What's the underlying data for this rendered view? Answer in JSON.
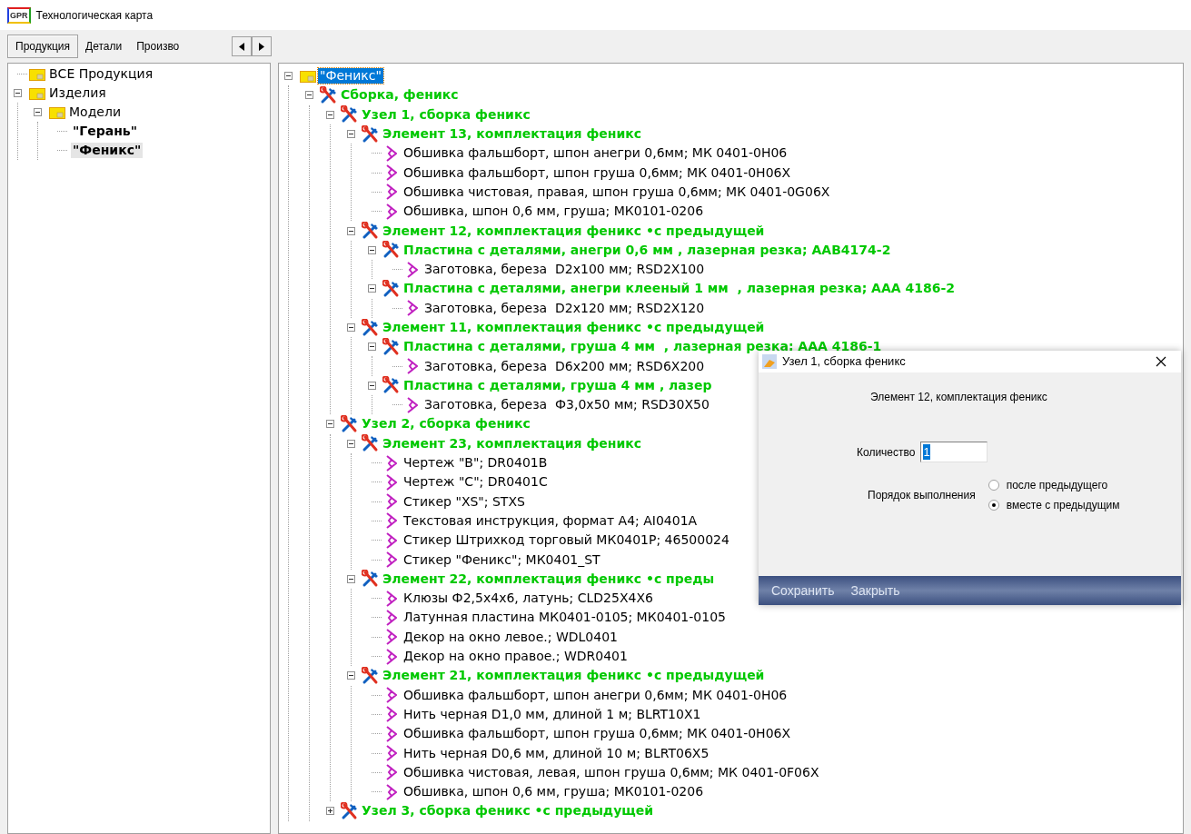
{
  "window": {
    "logo": "GPR",
    "title": "Технологическая карта"
  },
  "tabs": [
    {
      "label": "Продукция",
      "selected": true
    },
    {
      "label": "Детали",
      "selected": false
    },
    {
      "label": "Произво",
      "selected": false
    }
  ],
  "catalog": {
    "nodes": [
      {
        "label": "ВСЕ Продукция",
        "kind": "folder",
        "selected": false
      },
      {
        "label": "Изделия",
        "kind": "folder",
        "expanded": true,
        "selected": false,
        "children": [
          {
            "label": "Модели",
            "kind": "folder",
            "expanded": true,
            "selected": false,
            "children": [
              {
                "label": "\"Герань\"",
                "kind": "model",
                "selected": false
              },
              {
                "label": "\"Феникс\"",
                "kind": "model",
                "selected": true
              }
            ]
          }
        ]
      }
    ]
  },
  "tree": {
    "nodes": [
      {
        "label": "\"Феникс\"",
        "kind": "folder",
        "expanded": true,
        "selected": true,
        "children": [
          {
            "label": "Сборка, феникс",
            "kind": "assembly",
            "expanded": true,
            "selected": false,
            "children": [
              {
                "label": "Узел 1, сборка феникс",
                "kind": "assembly",
                "expanded": true,
                "selected": false,
                "children": [
                  {
                    "label": "Элемент 13, комплектация феникс",
                    "kind": "assembly",
                    "expanded": true,
                    "selected": false,
                    "children": [
                      {
                        "label": "Обшивка фальшборт, шпон анегри 0,6мм; МК 0401-0Н06",
                        "kind": "part",
                        "selected": false
                      },
                      {
                        "label": "Обшивка фальшборт, шпон груша 0,6мм; МК 0401-0Н06Х",
                        "kind": "part",
                        "selected": false
                      },
                      {
                        "label": "Обшивка чистовая, правая, шпон груша 0,6мм; МК 0401-0G06X",
                        "kind": "part",
                        "selected": false
                      },
                      {
                        "label": "Обшивка, шпон 0,6 мм, груша; МК0101-0206",
                        "kind": "part",
                        "selected": false
                      }
                    ]
                  },
                  {
                    "label": "Элемент 12, комплектация феникс •с предыдущей",
                    "kind": "assembly",
                    "expanded": true,
                    "selected": false,
                    "children": [
                      {
                        "label": "Пластина с деталями, анегри 0,6 мм , лазерная резка; ААВ4174-2",
                        "kind": "assembly",
                        "expanded": true,
                        "selected": false,
                        "children": [
                          {
                            "label": "Заготовка, береза  D2x100 мм; RSD2X100",
                            "kind": "part",
                            "selected": false
                          }
                        ]
                      },
                      {
                        "label": "Пластина с деталями, анегри клееный 1 мм  , лазерная резка; ААА 4186-2",
                        "kind": "assembly",
                        "expanded": true,
                        "selected": false,
                        "children": [
                          {
                            "label": "Заготовка, береза  D2x120 мм; RSD2X120",
                            "kind": "part",
                            "selected": false
                          }
                        ]
                      }
                    ]
                  },
                  {
                    "label": "Элемент 11, комплектация феникс •с предыдущей",
                    "kind": "assembly",
                    "expanded": true,
                    "selected": false,
                    "children": [
                      {
                        "label": "Пластина с деталями, груша 4 мм  , лазерная резка; ААА 4186-1",
                        "kind": "assembly",
                        "expanded": true,
                        "selected": false,
                        "children": [
                          {
                            "label": "Заготовка, береза  D6x200 мм; RSD6X200",
                            "kind": "part",
                            "selected": false
                          }
                        ]
                      },
                      {
                        "label": "Пластина с деталями, груша 4 мм , лазер",
                        "kind": "assembly",
                        "expanded": true,
                        "selected": false,
                        "children": [
                          {
                            "label": "Заготовка, береза  Ф3,0x50 мм; RSD30X50",
                            "kind": "part",
                            "selected": false
                          }
                        ]
                      }
                    ]
                  }
                ]
              },
              {
                "label": "Узел 2, сборка феникс",
                "kind": "assembly",
                "expanded": true,
                "selected": false,
                "children": [
                  {
                    "label": "Элемент 23, комплектация феникс",
                    "kind": "assembly",
                    "expanded": true,
                    "selected": false,
                    "children": [
                      {
                        "label": "Чертеж \"B\"; DR0401B",
                        "kind": "part",
                        "selected": false
                      },
                      {
                        "label": "Чертеж \"C\"; DR0401C",
                        "kind": "part",
                        "selected": false
                      },
                      {
                        "label": "Стикер \"XS\"; STXS",
                        "kind": "part",
                        "selected": false
                      },
                      {
                        "label": "Текстовая инструкция, формат А4; AI0401A",
                        "kind": "part",
                        "selected": false
                      },
                      {
                        "label": "Стикер Штрихкод торговый МК0401Р; 46500024",
                        "kind": "part",
                        "selected": false
                      },
                      {
                        "label": "Стикер \"Феникс\"; МК0401_ST",
                        "kind": "part",
                        "selected": false
                      }
                    ]
                  },
                  {
                    "label": "Элемент 22, комплектация феникс •с преды",
                    "kind": "assembly",
                    "expanded": true,
                    "selected": false,
                    "children": [
                      {
                        "label": "Клюзы Ф2,5х4х6, латунь; CLD25X4X6",
                        "kind": "part",
                        "selected": false
                      },
                      {
                        "label": "Латунная пластина МК0401-0105; МК0401-0105",
                        "kind": "part",
                        "selected": false
                      },
                      {
                        "label": "Декор на окно левое.; WDL0401",
                        "kind": "part",
                        "selected": false
                      },
                      {
                        "label": "Декор на окно правое.; WDR0401",
                        "kind": "part",
                        "selected": false
                      }
                    ]
                  },
                  {
                    "label": "Элемент 21, комплектация феникс •с предыдущей",
                    "kind": "assembly",
                    "expanded": true,
                    "selected": false,
                    "children": [
                      {
                        "label": "Обшивка фальшборт, шпон анегри 0,6мм; МК 0401-0Н06",
                        "kind": "part",
                        "selected": false
                      },
                      {
                        "label": "Нить черная D1,0 мм, длиной 1 м; BLRT10X1",
                        "kind": "part",
                        "selected": false
                      },
                      {
                        "label": "Обшивка фальшборт, шпон груша 0,6мм; МК 0401-0Н06Х",
                        "kind": "part",
                        "selected": false
                      },
                      {
                        "label": "Нить черная D0,6 мм, длиной 10 м; BLRT06X5",
                        "kind": "part",
                        "selected": false
                      },
                      {
                        "label": "Обшивка чистовая, левая, шпон груша 0,6мм; МК 0401-0F06X",
                        "kind": "part",
                        "selected": false
                      },
                      {
                        "label": "Обшивка, шпон 0,6 мм, груша; МК0101-0206",
                        "kind": "part",
                        "selected": false
                      }
                    ]
                  }
                ]
              },
              {
                "label": "Узел 3, сборка феникс •с предыдущей",
                "kind": "assembly",
                "expanded": false,
                "selected": false
              }
            ]
          }
        ]
      }
    ]
  },
  "dialog": {
    "title": "Узел 1, сборка феникс",
    "heading": "Элемент 12, комплектация феникс",
    "quantity": {
      "label": "Количество",
      "value": "1"
    },
    "order": {
      "label": "Порядок выполнения",
      "options": [
        {
          "label": "после предыдущего",
          "selected": false
        },
        {
          "label": "вместе с предыдущим",
          "selected": true
        }
      ]
    },
    "buttons": [
      "Сохранить",
      "Закрыть"
    ]
  }
}
